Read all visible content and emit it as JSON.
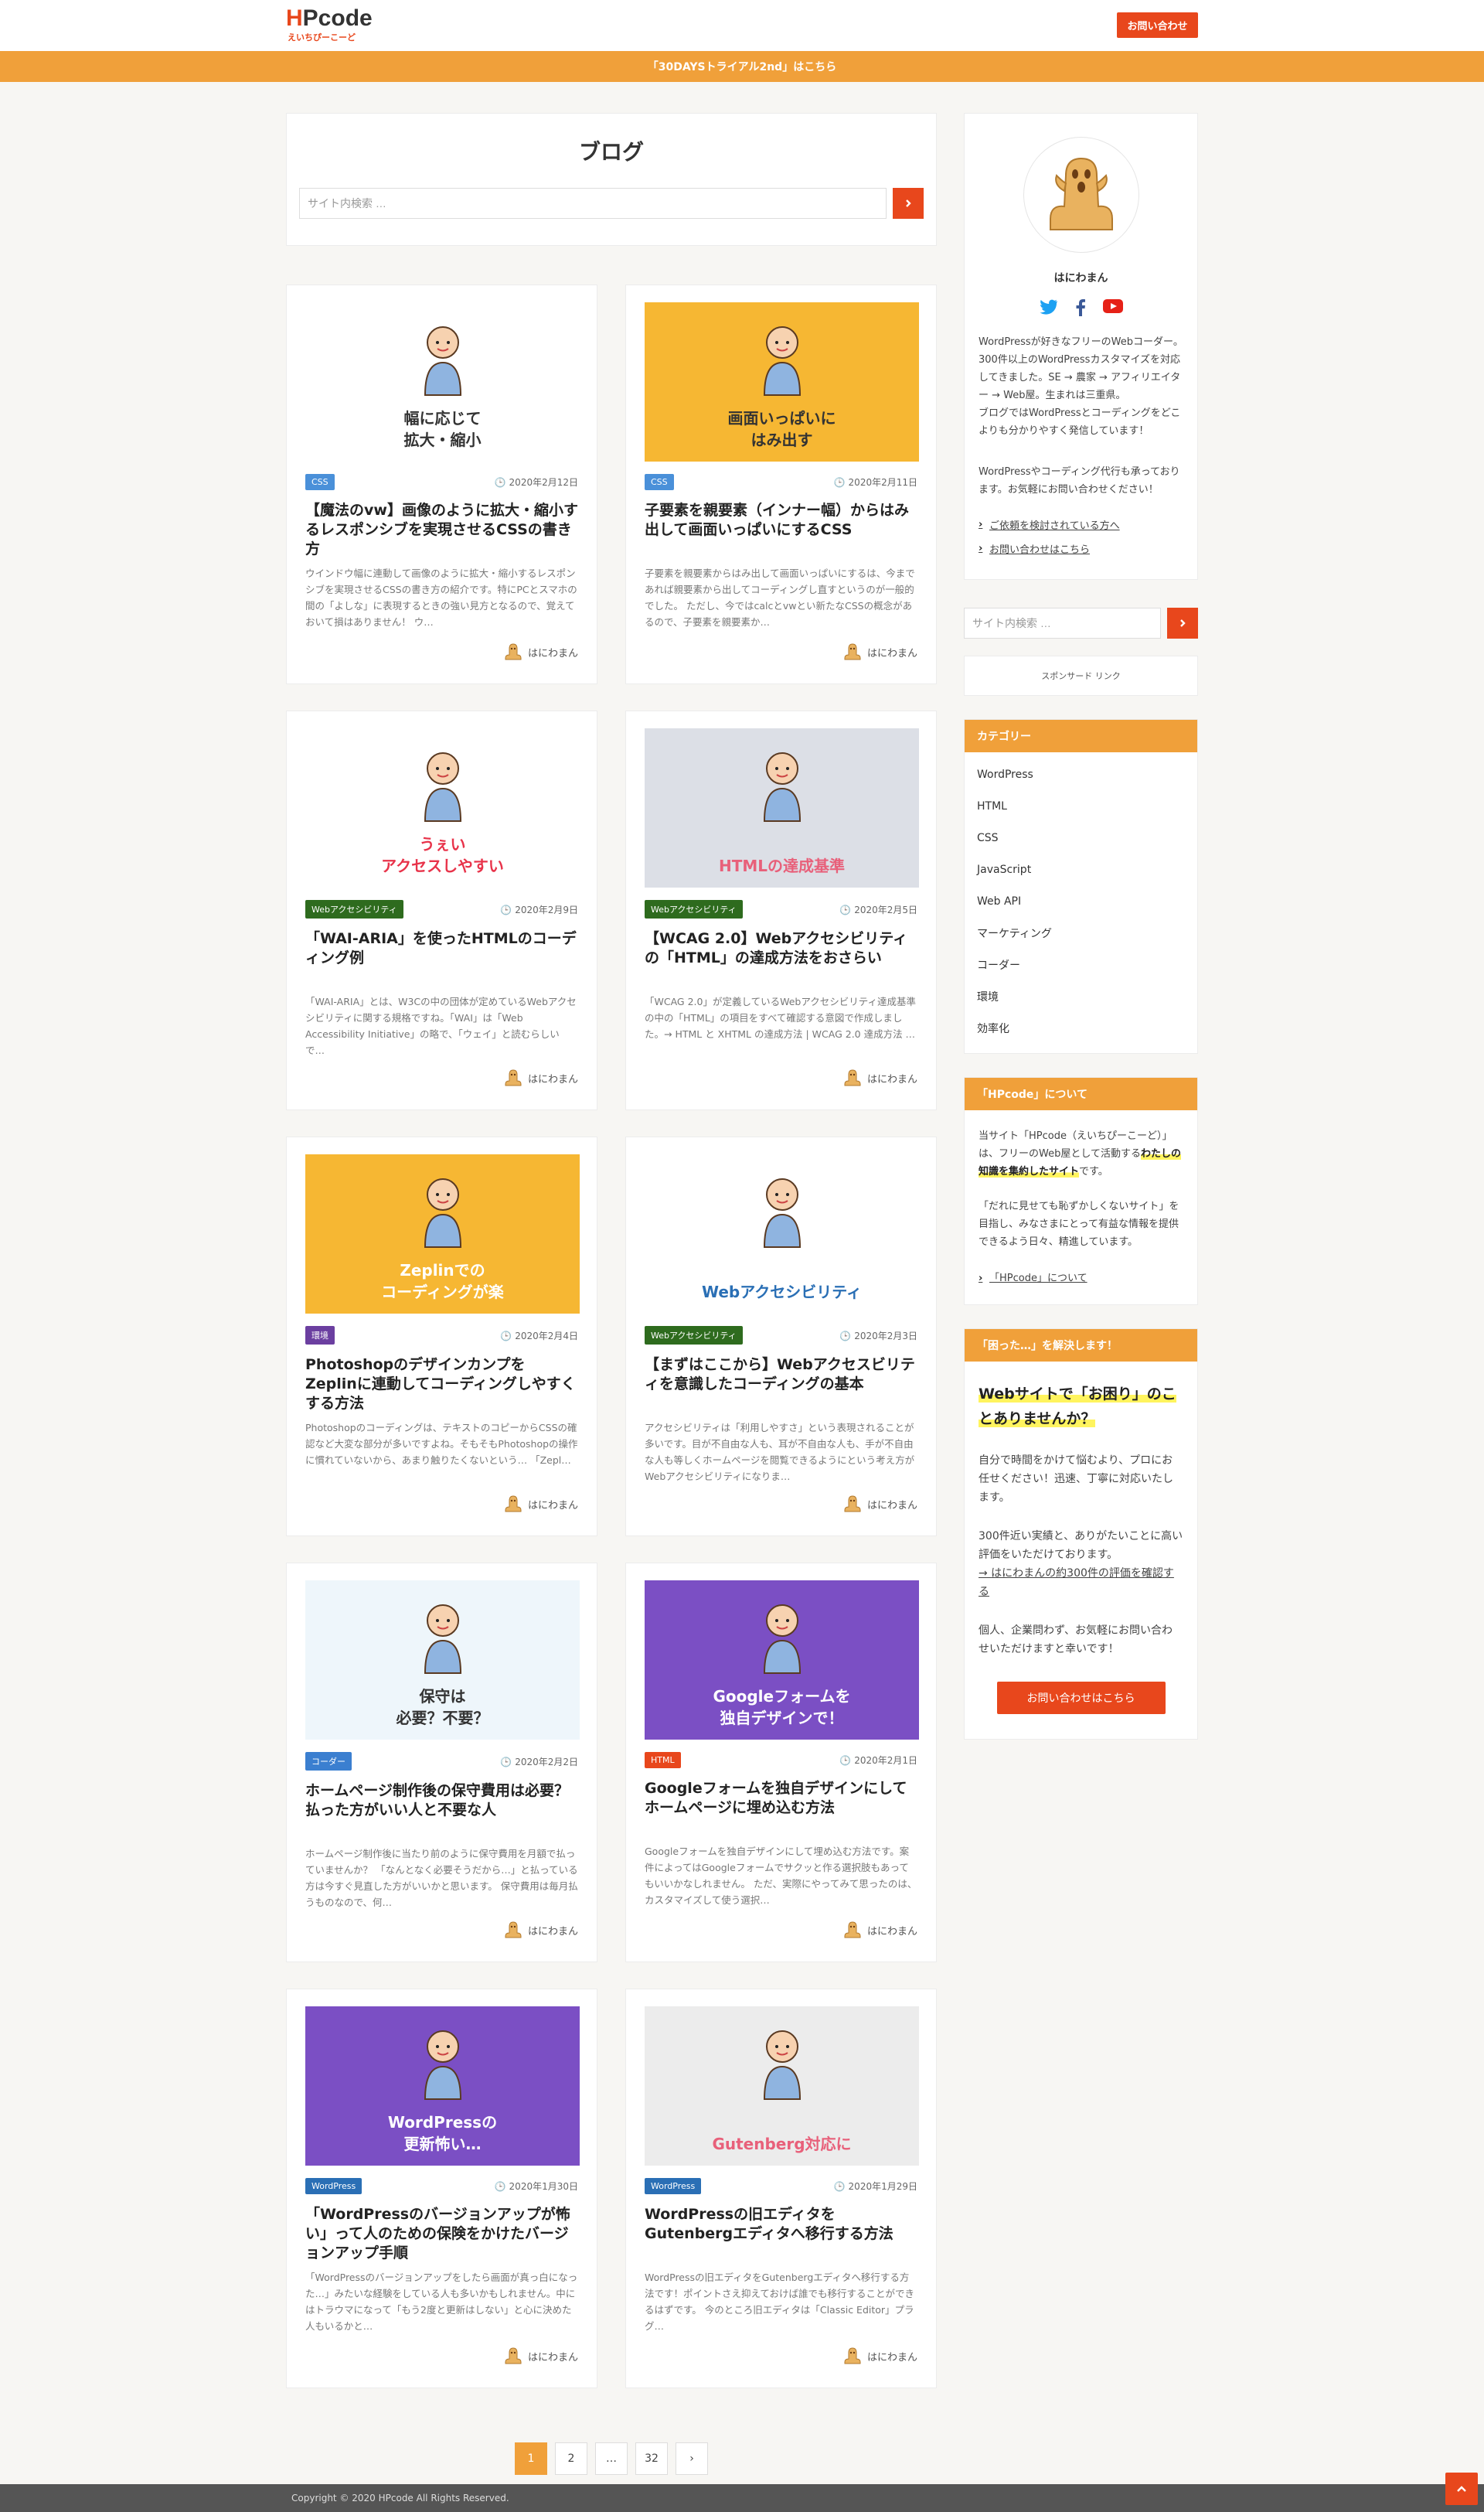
{
  "header": {
    "logo_accent": "H",
    "logo_rest": "Pcode",
    "logo_sub": "えいちぴーこーど",
    "contact_label": "お問い合わせ",
    "notice": "「30DAYSトライアル2nd」はこちら"
  },
  "blog": {
    "title": "ブログ",
    "search_placeholder": "サイト内検索 …"
  },
  "posts": [
    {
      "thumb_title": "幅に応じて\n拡大・縮小",
      "thumb_bg": "#ffffff",
      "thumb_color": "#333333",
      "tag": "CSS",
      "tag_color": "#4a90d9",
      "date": "2020年2月12日",
      "title": "【魔法のvw】画像のように拡大・縮小するレスポンシブを実現させるCSSの書き方",
      "excerpt": "ウインドウ幅に連動して画像のように拡大・縮小するレスポンシブを実現させるCSSの書き方の紹介です。特にPCとスマホの間の「よしな」に表現するときの強い見方となるので、覚えておいて損はありません！ ウ…",
      "author": "はにわまん"
    },
    {
      "thumb_title": "画面いっぱいに\nはみ出す",
      "thumb_bg": "#f6b733",
      "thumb_color": "#333333",
      "tag": "CSS",
      "tag_color": "#4a90d9",
      "date": "2020年2月11日",
      "title": "子要素を親要素（インナー幅）からはみ出して画面いっぱいにするCSS",
      "excerpt": "子要素を親要素からはみ出して画面いっぱいにするは、今まであれば親要素から出してコーディングし直すというのが一般的でした。 ただし、今ではcalcとvwとい新たなCSSの概念があるので、子要素を親要素か…",
      "author": "はにわまん"
    },
    {
      "thumb_title": "うぇい\nアクセスしやすい",
      "thumb_bg": "#ffffff",
      "thumb_color": "#e8334a",
      "tag": "Webアクセシビリティ",
      "tag_color": "#2e6b1e",
      "date": "2020年2月9日",
      "title": "「WAI-ARIA」を使ったHTMLのコーディング例",
      "excerpt": "「WAI-ARIA」とは、W3Cの中の団体が定めているWebアクセシビリティに関する規格ですね。「WAI」は「Web Accessibility Initiative」の略で、「ウェイ」と読むらしいで…",
      "author": "はにわまん"
    },
    {
      "thumb_title": "HTMLの達成基準",
      "thumb_bg": "#dcdfe6",
      "thumb_color": "#e8607a",
      "tag": "Webアクセシビリティ",
      "tag_color": "#2e6b1e",
      "date": "2020年2月5日",
      "title": "【WCAG 2.0】Webアクセシビリティの「HTML」の達成方法をおさらい",
      "excerpt": "「WCAG 2.0」が定義しているWebアクセシビリティ達成基準の中の「HTML」の項目をすべて確認する意図で作成しました。→ HTML と XHTML の達成方法 | WCAG 2.0 達成方法 …",
      "author": "はにわまん"
    },
    {
      "thumb_title": "Zeplinでの\nコーディングが楽",
      "thumb_bg": "#f6b733",
      "thumb_color": "#ffffff",
      "tag": "環境",
      "tag_color": "#6b3fa0",
      "date": "2020年2月4日",
      "title": "Photoshopのデザインカンプを Zeplinに連動してコーディングしやすくする方法",
      "excerpt": "Photoshopのコーディングは、テキストのコピーからCSSの確認など大変な部分が多いですよね。そもそもPhotoshopの操作に慣れていないから、あまり触りたくないという… 「Zepl…",
      "author": "はにわまん"
    },
    {
      "thumb_title": "Webアクセシビリティ",
      "thumb_bg": "#ffffff",
      "thumb_color": "#2a6fb5",
      "tag": "Webアクセシビリティ",
      "tag_color": "#2e6b1e",
      "date": "2020年2月3日",
      "title": "【まずはここから】Webアクセスビリティを意識したコーディングの基本",
      "excerpt": "アクセシビリティは「利用しやすさ」という表現されることが多いです。目が不自由な人も、耳が不自由な人も、手が不自由な人も等しくホームページを閲覧できるようにという考え方がWebアクセシビリティになりま…",
      "author": "はにわまん"
    },
    {
      "thumb_title": "保守は\n必要？不要？",
      "thumb_bg": "#eef6fb",
      "thumb_color": "#333333",
      "tag": "コーダー",
      "tag_color": "#3b7fd0",
      "date": "2020年2月2日",
      "title": "ホームページ制作後の保守費用は必要？払った方がいい人と不要な人",
      "excerpt": "ホームページ制作後に当たり前のように保守費用を月額で払っていませんか？ 「なんとなく必要そうだから…」と払っている方は今すぐ見直した方がいいかと思います。 保守費用は毎月払うものなので、何…",
      "author": "はにわまん"
    },
    {
      "thumb_title": "Googleフォームを\n独自デザインで！",
      "thumb_bg": "#7b4fc4",
      "thumb_color": "#ffffff",
      "tag": "HTML",
      "tag_color": "#e8471c",
      "date": "2020年2月1日",
      "title": "Googleフォームを独自デザインにしてホームページに埋め込む方法",
      "excerpt": "Googleフォームを独自デザインにして埋め込む方法です。案件によってはGoogleフォームでサクッと作る選択肢もあってもいいかなしれません。 ただ、実際にやってみて思ったのは、カスタマイズして使う選択…",
      "author": "はにわまん"
    },
    {
      "thumb_title": "WordPressの\n更新怖い…",
      "thumb_bg": "#7b4fc4",
      "thumb_color": "#ffffff",
      "tag": "WordPress",
      "tag_color": "#2a6fb5",
      "date": "2020年1月30日",
      "title": "「WordPressのバージョンアップが怖い」って人のための保険をかけたバージョンアップ手順",
      "excerpt": "「WordPressのバージョンアップをしたら画面が真っ白になった…」みたいな経験をしている人も多いかもしれません。中にはトラウマになって「もう2度と更新はしない」と心に決めた人もいるかと…",
      "author": "はにわまん"
    },
    {
      "thumb_title": "Gutenberg対応に",
      "thumb_bg": "#ececec",
      "thumb_color": "#e8607a",
      "tag": "WordPress",
      "tag_color": "#2a6fb5",
      "date": "2020年1月29日",
      "title": "WordPressの旧エディタを Gutenbergエディタへ移行する方法",
      "excerpt": "WordPressの旧エディタをGutenbergエディタへ移行する方法です！ポイントさえ抑えておけば誰でも移行することができるはずです。 今のところ旧エディタは「Classic Editor」プラグ…",
      "author": "はにわまん"
    }
  ],
  "pager": {
    "p1": "1",
    "p2": "2",
    "dots": "…",
    "last": "32",
    "next": "›"
  },
  "sidebar": {
    "profile_name": "はにわまん",
    "profile_text": "WordPressが好きなフリーのWebコーダー。300件以上のWordPressカスタマイズを対応してきました。SE → 農家 → アフィリエイター → Web屋。生まれは三重県。\nブログではWordPressとコーディングをどこよりも分かりやすく発信しています！",
    "profile_text2": "WordPressやコーディング代行も承っております。お気軽にお問い合わせください！",
    "link1": "ご依頼を検討されている方へ",
    "link2": "お問い合わせはこちら",
    "search_placeholder": "サイト内検索 …",
    "sponsored": "スポンサード リンク",
    "categories_head": "カテゴリー",
    "categories": [
      "WordPress",
      "HTML",
      "CSS",
      "JavaScript",
      "Web API",
      "マーケティング",
      "コーダー",
      "環境",
      "効率化"
    ],
    "about_head": "「HPcode」について",
    "about_p1a": "当サイト「HPcode（えいちぴーこーど）」は、フリーのWeb屋として活動する",
    "about_p1b": "わたしの知識を集約したサイト",
    "about_p1c": "です。",
    "about_p2": "「だれに見せても恥ずかしくないサイト」を目指し、みなさまにとって有益な情報を提供できるよう日々、精進しています。",
    "about_link": "「HPcode」について",
    "help_head": "「困った…」を解決します！",
    "help_title": "Webサイトで「お困り」のことありませんか？",
    "help_p1": "自分で時間をかけて悩むより、プロにお任せください！迅速、丁寧に対応いたします。",
    "help_p2a": "300件近い実績と、ありがたいことに高い評価をいただけております。",
    "help_p2b": "→ はにわまんの約300件の評価を確認する",
    "help_p3": "個人、企業問わず、お気軽にお問い合わせいただけますと幸いです！",
    "help_btn": "お問い合わせはこちら"
  },
  "footer": {
    "copyright": "Copyright © 2020 HPcode All Rights Reserved."
  },
  "colors": {
    "accent": "#e8471c",
    "orange": "#f0a03a"
  }
}
